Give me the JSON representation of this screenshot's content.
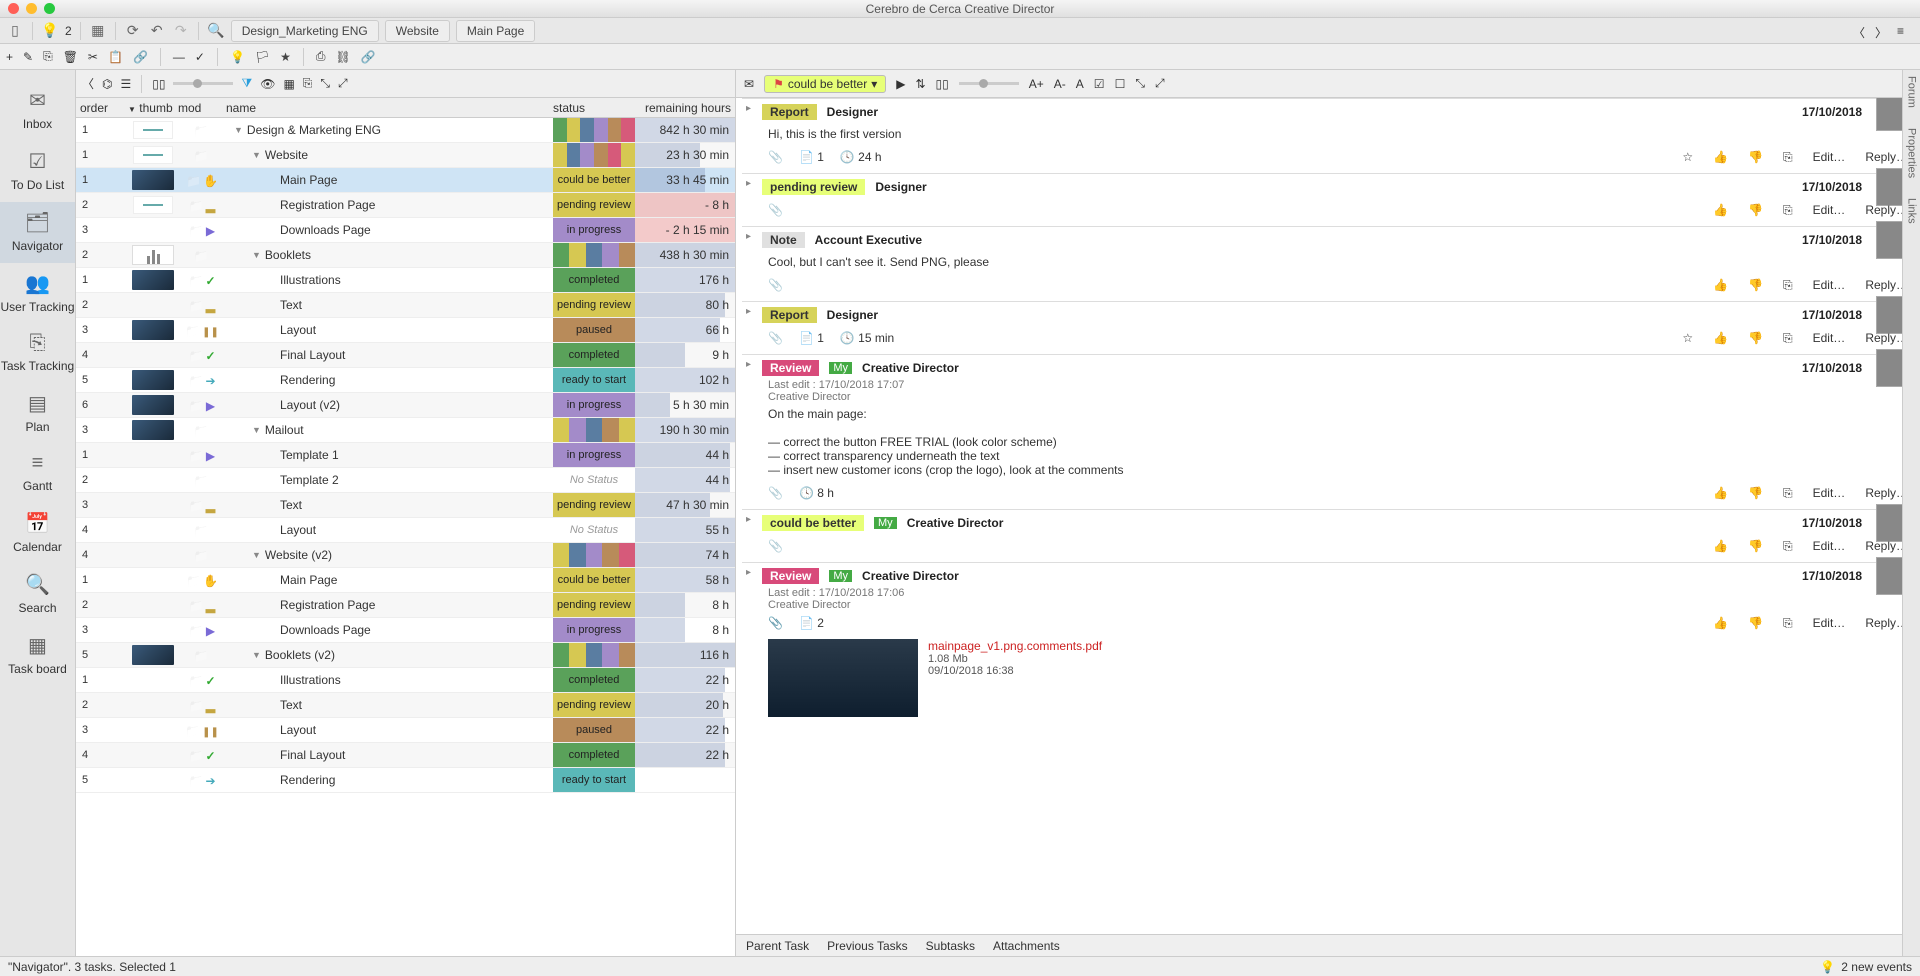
{
  "window": {
    "title": "Cerebro de Cerca   Creative Director",
    "bulb_count": "2"
  },
  "breadcrumbs": [
    "Design_Marketing ENG",
    "Website",
    "Main Page"
  ],
  "left_nav": [
    {
      "icon": "✉",
      "label": "Inbox"
    },
    {
      "icon": "☑",
      "label": "To Do List"
    },
    {
      "icon": "🗂",
      "label": "Navigator",
      "active": true
    },
    {
      "icon": "👥",
      "label": "User Tracking"
    },
    {
      "icon": "⎘",
      "label": "Task Tracking"
    },
    {
      "icon": "▤",
      "label": "Plan"
    },
    {
      "icon": "≡",
      "label": "Gantt"
    },
    {
      "icon": "📅",
      "label": "Calendar"
    },
    {
      "icon": "🔍",
      "label": "Search"
    },
    {
      "icon": "▦",
      "label": "Task board"
    }
  ],
  "columns": {
    "order": "order",
    "thumb": "thumb",
    "mod": "mod",
    "name": "name",
    "status": "status",
    "remain": "remaining hours"
  },
  "rows": [
    {
      "order": "1",
      "thumb": "sky",
      "mod": "",
      "name": "Design & Marketing ENG",
      "indent": 0,
      "disc": true,
      "stripes": [
        "c-a",
        "c-d",
        "c-b",
        "c-e",
        "c-h",
        "c-f"
      ],
      "remain": "842 h 30 min",
      "bar": 100
    },
    {
      "order": "1",
      "thumb": "sky",
      "mod": "",
      "name": "Website",
      "indent": 1,
      "disc": true,
      "stripes": [
        "c-d",
        "c-b",
        "c-e",
        "c-h",
        "c-f",
        "c-d"
      ],
      "remain": "23 h 30 min",
      "bar": 65
    },
    {
      "order": "1",
      "thumb": "img",
      "mod": "hand",
      "name": "Main Page",
      "indent": 2,
      "status": "could be better",
      "statusColor": "#d6c852",
      "remain": "33 h 45 min",
      "bar": 70,
      "selected": true
    },
    {
      "order": "2",
      "thumb": "sky",
      "mod": "stamp",
      "name": "Registration Page",
      "indent": 2,
      "status": "pending review",
      "statusColor": "#d6c852",
      "remain": "- 8 h",
      "bar": 0,
      "over": true
    },
    {
      "order": "3",
      "thumb": "",
      "mod": "play",
      "name": "Downloads Page",
      "indent": 2,
      "status": "in progress",
      "statusColor": "#a38bc9",
      "remain": "- 2 h 15 min",
      "bar": 0,
      "over": true
    },
    {
      "order": "2",
      "thumb": "chart",
      "mod": "",
      "name": "Booklets",
      "indent": 1,
      "disc": true,
      "stripes": [
        "c-a",
        "c-d",
        "c-b",
        "c-e",
        "c-h"
      ],
      "remain": "438 h 30 min",
      "bar": 100
    },
    {
      "order": "1",
      "thumb": "img",
      "mod": "check",
      "name": "Illustrations",
      "indent": 2,
      "status": "completed",
      "statusColor": "#5aa15a",
      "remain": "176 h",
      "bar": 100
    },
    {
      "order": "2",
      "thumb": "",
      "mod": "stamp",
      "name": "Text",
      "indent": 2,
      "status": "pending review",
      "statusColor": "#d6c852",
      "remain": "80 h",
      "bar": 90
    },
    {
      "order": "3",
      "thumb": "img",
      "mod": "pause",
      "name": "Layout",
      "indent": 2,
      "status": "paused",
      "statusColor": "#b88b5a",
      "remain": "66 h",
      "bar": 85
    },
    {
      "order": "4",
      "thumb": "",
      "mod": "check",
      "name": "Final Layout",
      "indent": 2,
      "status": "completed",
      "statusColor": "#5aa15a",
      "remain": "9 h",
      "bar": 50
    },
    {
      "order": "5",
      "thumb": "img",
      "mod": "arrow",
      "name": "Rendering",
      "indent": 2,
      "status": "ready to start",
      "statusColor": "#5ab8b8",
      "remain": "102 h",
      "bar": 100
    },
    {
      "order": "6",
      "thumb": "img",
      "mod": "play",
      "name": "Layout (v2)",
      "indent": 2,
      "status": "in progress",
      "statusColor": "#a38bc9",
      "remain": "5 h 30 min",
      "bar": 35
    },
    {
      "order": "3",
      "thumb": "img",
      "mod": "",
      "name": "Mailout",
      "indent": 1,
      "disc": true,
      "stripes": [
        "c-d",
        "c-e",
        "c-b",
        "c-h",
        "c-d"
      ],
      "remain": "190 h 30 min",
      "bar": 100
    },
    {
      "order": "1",
      "thumb": "",
      "mod": "play",
      "name": "Template 1",
      "indent": 2,
      "status": "in progress",
      "statusColor": "#a38bc9",
      "remain": "44 h",
      "bar": 95
    },
    {
      "order": "2",
      "thumb": "",
      "mod": "",
      "name": "Template 2",
      "indent": 2,
      "status": "No Status",
      "statusColor": "",
      "nostatus": true,
      "remain": "44 h",
      "bar": 95
    },
    {
      "order": "3",
      "thumb": "",
      "mod": "stamp",
      "name": "Text",
      "indent": 2,
      "status": "pending review",
      "statusColor": "#d6c852",
      "remain": "47 h 30 min",
      "bar": 75
    },
    {
      "order": "4",
      "thumb": "",
      "mod": "",
      "name": "Layout",
      "indent": 2,
      "status": "No Status",
      "statusColor": "",
      "nostatus": true,
      "remain": "55 h",
      "bar": 100
    },
    {
      "order": "4",
      "thumb": "",
      "mod": "",
      "name": "Website (v2)",
      "indent": 1,
      "disc": true,
      "stripes": [
        "c-d",
        "c-b",
        "c-e",
        "c-h",
        "c-f"
      ],
      "remain": "74 h",
      "bar": 100
    },
    {
      "order": "1",
      "thumb": "",
      "mod": "hand",
      "name": "Main Page",
      "indent": 2,
      "status": "could be better",
      "statusColor": "#d6c852",
      "remain": "58 h",
      "bar": 100
    },
    {
      "order": "2",
      "thumb": "",
      "mod": "stamp",
      "name": "Registration Page",
      "indent": 2,
      "status": "pending review",
      "statusColor": "#d6c852",
      "remain": "8 h",
      "bar": 50
    },
    {
      "order": "3",
      "thumb": "",
      "mod": "play",
      "name": "Downloads Page",
      "indent": 2,
      "status": "in progress",
      "statusColor": "#a38bc9",
      "remain": "8 h",
      "bar": 50
    },
    {
      "order": "5",
      "thumb": "img",
      "mod": "",
      "name": "Booklets (v2)",
      "indent": 1,
      "disc": true,
      "stripes": [
        "c-a",
        "c-d",
        "c-b",
        "c-e",
        "c-h"
      ],
      "remain": "116 h",
      "bar": 100
    },
    {
      "order": "1",
      "thumb": "",
      "mod": "check",
      "name": "Illustrations",
      "indent": 2,
      "status": "completed",
      "statusColor": "#5aa15a",
      "remain": "22 h",
      "bar": 90
    },
    {
      "order": "2",
      "thumb": "",
      "mod": "stamp",
      "name": "Text",
      "indent": 2,
      "status": "pending review",
      "statusColor": "#d6c852",
      "remain": "20 h",
      "bar": 88
    },
    {
      "order": "3",
      "thumb": "",
      "mod": "pause",
      "name": "Layout",
      "indent": 2,
      "status": "paused",
      "statusColor": "#b88b5a",
      "remain": "22 h",
      "bar": 90
    },
    {
      "order": "4",
      "thumb": "",
      "mod": "check",
      "name": "Final Layout",
      "indent": 2,
      "status": "completed",
      "statusColor": "#5aa15a",
      "remain": "22 h",
      "bar": 90
    },
    {
      "order": "5",
      "thumb": "",
      "mod": "arrow",
      "name": "Rendering",
      "indent": 2,
      "status": "ready to start",
      "statusColor": "#5ab8b8",
      "remain": "",
      "bar": 0
    }
  ],
  "right_toolbar": {
    "status": "could be better"
  },
  "forum": [
    {
      "type": "Report",
      "labcls": "lab-report",
      "author": "Designer",
      "date": "17/10/2018",
      "avatar": "av1",
      "body": "Hi, this is the first version",
      "doc": "1",
      "clock": "24 h",
      "star": true
    },
    {
      "type": "pending review",
      "labcls": "lab-pending",
      "author": "Designer",
      "date": "17/10/2018",
      "avatar": "av1",
      "body": ""
    },
    {
      "type": "Note",
      "labcls": "lab-note",
      "author": "Account Executive",
      "date": "17/10/2018",
      "avatar": "av2",
      "body": "Cool, but I can't see it. Send PNG, please"
    },
    {
      "type": "Report",
      "labcls": "lab-report",
      "author": "Designer",
      "date": "17/10/2018",
      "avatar": "av1",
      "body": "",
      "doc": "1",
      "clock": "15 min",
      "star": true
    },
    {
      "type": "Review",
      "labcls": "lab-review",
      "my": true,
      "author": "Creative Director",
      "date": "17/10/2018",
      "avatar": "av2",
      "meta1": "Last edit : 17/10/2018 17:07",
      "meta2": "Creative Director",
      "body": "On the main page:\n\n— correct the button FREE TRIAL (look color scheme)\n— correct transparency underneath the text\n— insert new customer icons (crop the logo), look at the comments",
      "clock": "8 h"
    },
    {
      "type": "could be better",
      "labcls": "lab-cbb",
      "my": true,
      "author": "Creative Director",
      "date": "17/10/2018",
      "avatar": "av2",
      "body": ""
    },
    {
      "type": "Review",
      "labcls": "lab-review",
      "my": true,
      "author": "Creative Director",
      "date": "17/10/2018",
      "avatar": "av2",
      "meta1": "Last edit : 17/10/2018 17:06",
      "meta2": "Creative Director",
      "body": "",
      "doc": "2",
      "attach": {
        "name": "mainpage_v1.png.comments.pdf",
        "size": "1.08 Mb",
        "time": "09/10/2018 16:38"
      }
    }
  ],
  "right_tabs": [
    "Parent Task",
    "Previous Tasks",
    "Subtasks",
    "Attachments"
  ],
  "right_strip": [
    "Forum",
    "Properties",
    "Links"
  ],
  "status": {
    "left": "\"Navigator\". 3 tasks. Selected 1",
    "right": "2 new events"
  },
  "act": {
    "edit": "Edit…",
    "reply": "Reply…"
  }
}
